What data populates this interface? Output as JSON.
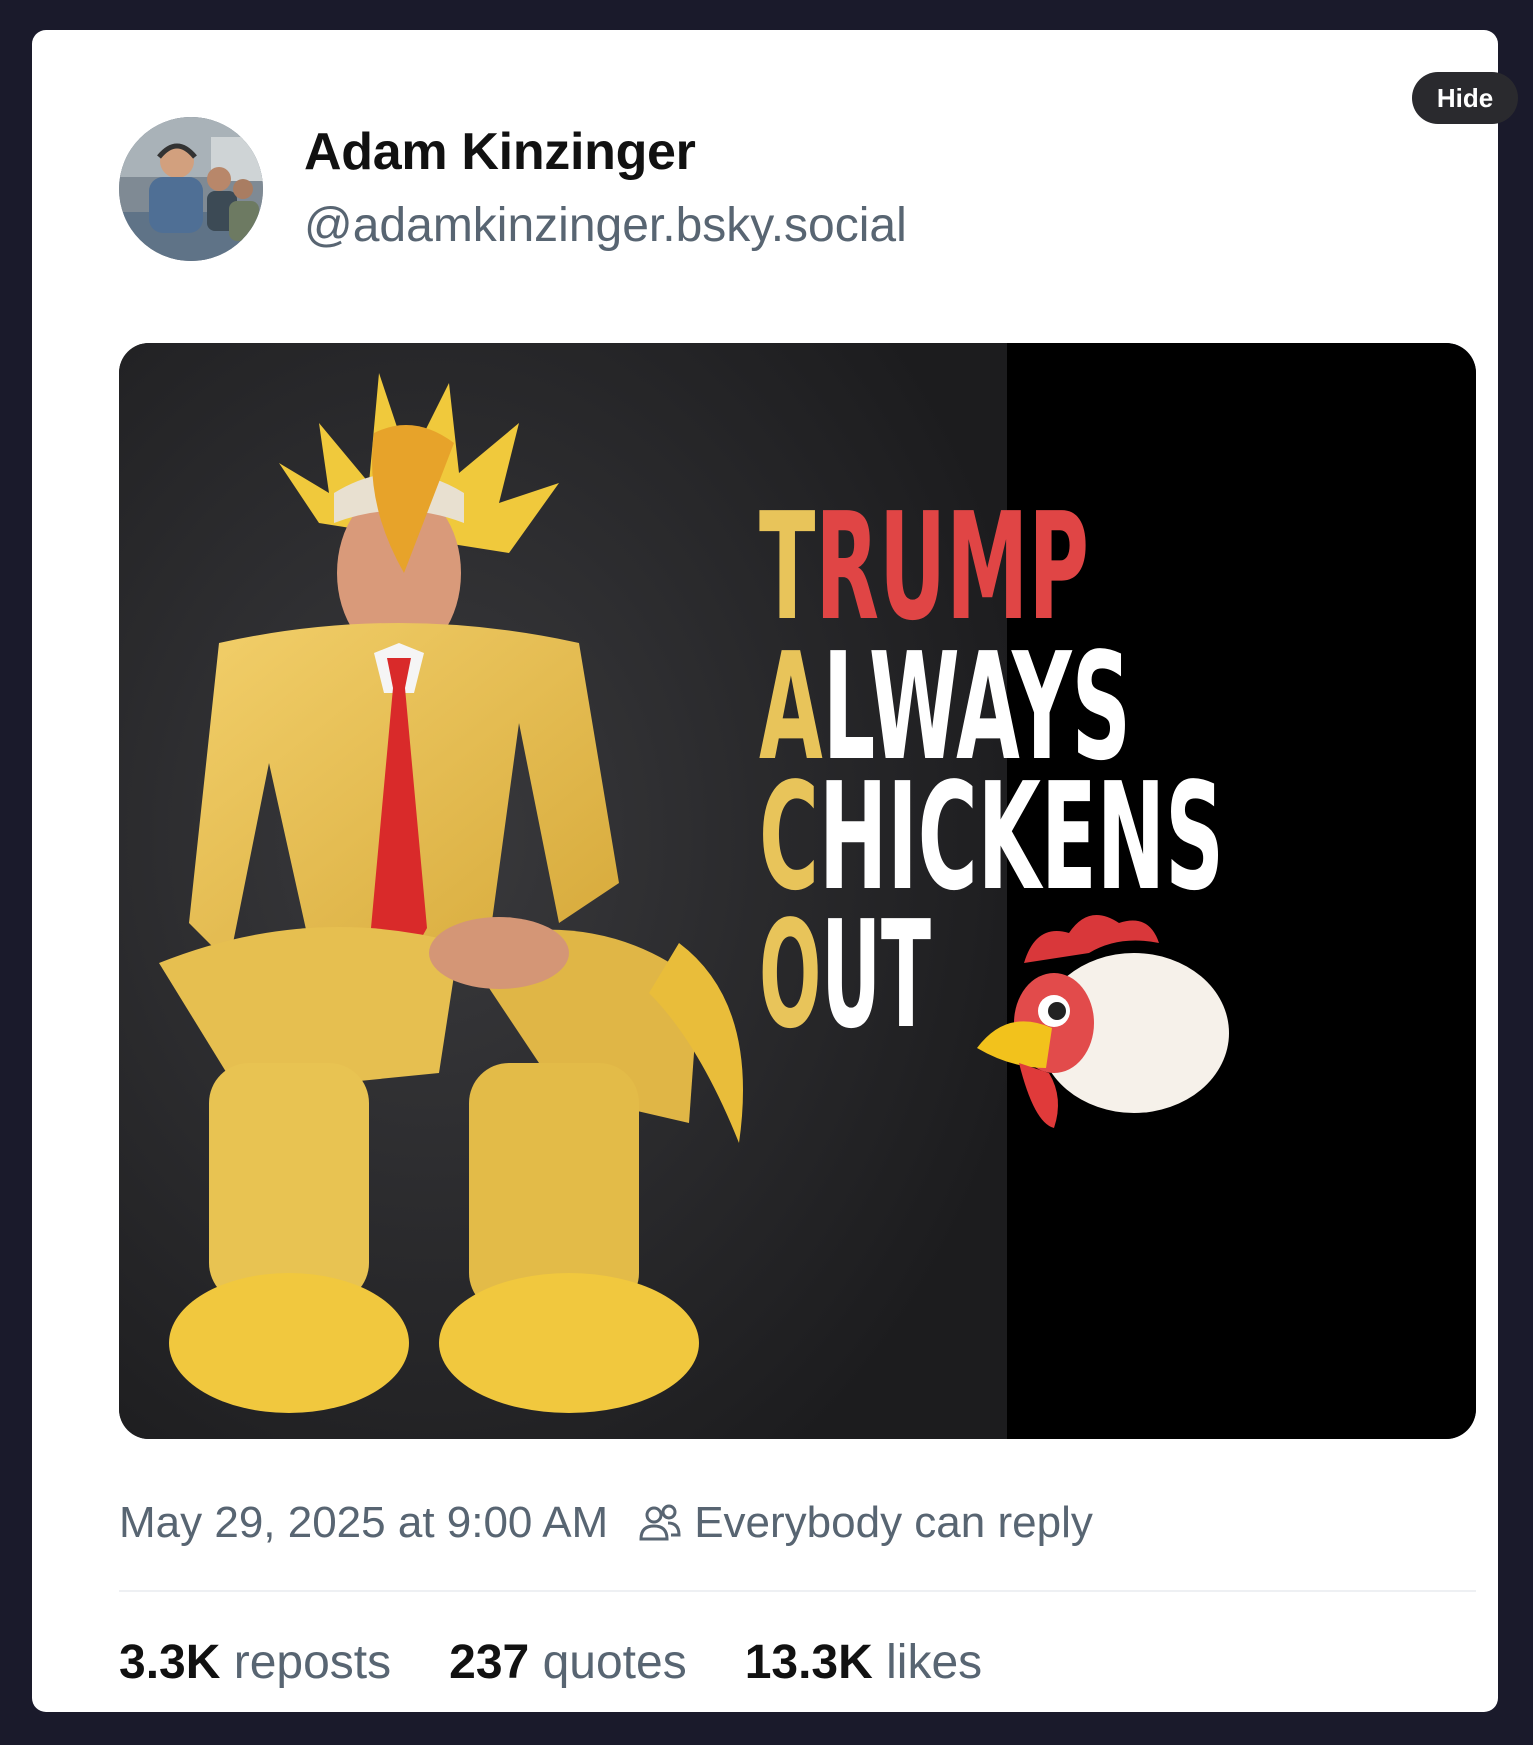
{
  "post": {
    "author": {
      "display_name": "Adam Kinzinger",
      "handle": "@adamkinzinger.bsky.social"
    },
    "hide_label": "Hide",
    "image": {
      "poster_lines": [
        {
          "initial": "T",
          "rest": "RUMP"
        },
        {
          "initial": "A",
          "rest": "LWAYS"
        },
        {
          "initial": "C",
          "rest": "HICKENS"
        },
        {
          "initial": "O",
          "rest": "UT"
        }
      ],
      "colors": {
        "initial": "#e8c45a",
        "line1": "#e04545",
        "text": "#ffffff"
      },
      "emoji": "chicken-head-icon"
    },
    "timestamp": "May 29, 2025 at 9:00 AM",
    "reply_setting": "Everybody can reply",
    "stats": {
      "reposts_count": "3.3K",
      "reposts_label": "reposts",
      "quotes_count": "237",
      "quotes_label": "quotes",
      "likes_count": "13.3K",
      "likes_label": "likes"
    }
  }
}
